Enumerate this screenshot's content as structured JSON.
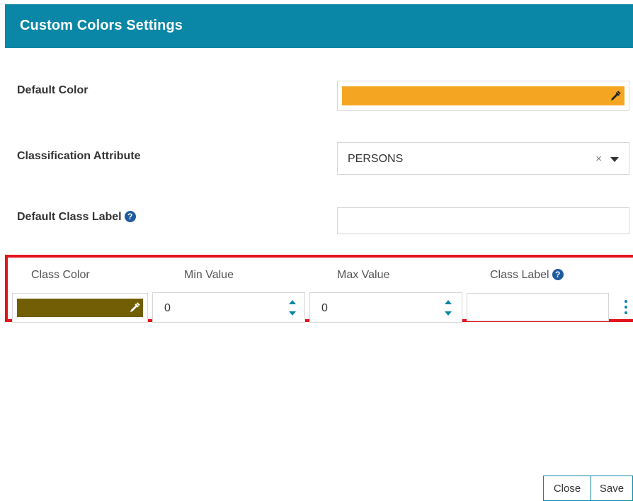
{
  "dialog": {
    "title": "Custom Colors Settings"
  },
  "form": {
    "default_color": {
      "label": "Default Color",
      "value": "#f4a623"
    },
    "classification_attribute": {
      "label": "Classification Attribute",
      "value": "PERSONS",
      "clear_symbol": "×"
    },
    "default_class_label": {
      "label": "Default Class Label",
      "value": ""
    }
  },
  "class_table": {
    "headers": {
      "class_color": "Class Color",
      "min_value": "Min Value",
      "max_value": "Max Value",
      "class_label": "Class Label"
    },
    "rows": [
      {
        "color": "#725f05",
        "min_value": "0",
        "max_value": "0",
        "class_label": ""
      }
    ]
  },
  "buttons": {
    "close": "Close",
    "save": "Save"
  },
  "colors": {
    "header_bg": "#0a87a6",
    "accent": "#0a87a6",
    "highlight_border": "#e3141d",
    "help_icon": "#1f5a9e"
  }
}
